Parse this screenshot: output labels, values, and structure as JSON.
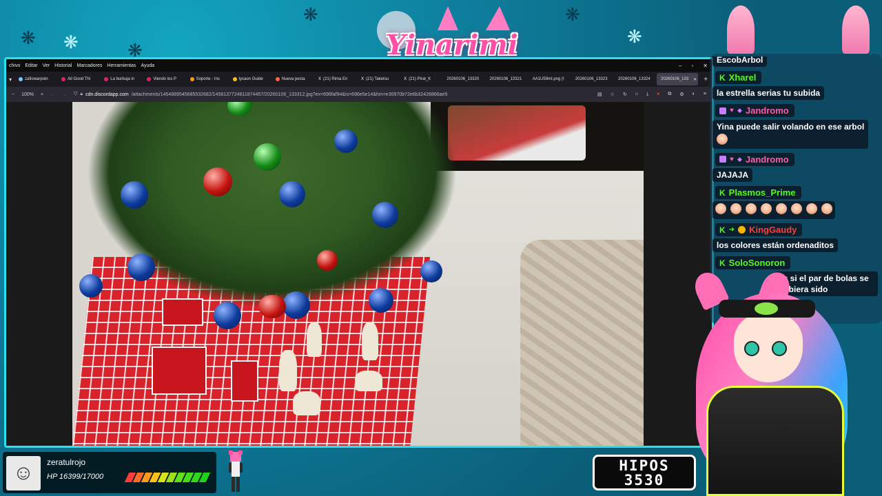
{
  "overlay": {
    "logo_text": "Yinarimi"
  },
  "browser": {
    "menu": [
      "chivo",
      "Editar",
      "Ver",
      "Historial",
      "Marcadores",
      "Herramientas",
      "Ayuda"
    ],
    "tabs": [
      {
        "label": "zafiowarpoin",
        "active": false
      },
      {
        "label": "All Good Thi",
        "active": false
      },
      {
        "label": "La burbuja in",
        "active": false
      },
      {
        "label": "Viendo los P",
        "active": false
      },
      {
        "label": "Soporte - Ins",
        "active": false
      },
      {
        "label": "lycaon Guide",
        "active": false
      },
      {
        "label": "Nueva pesta",
        "active": false
      },
      {
        "label": "(21) Rima En",
        "active": false
      },
      {
        "label": "(21) Taketsu",
        "active": false
      },
      {
        "label": "(21) Pirat_K",
        "active": false
      },
      {
        "label": "20260106_13320",
        "active": false
      },
      {
        "label": "20260106_13321",
        "active": false
      },
      {
        "label": "AA1U59mI.png (I",
        "active": false
      },
      {
        "label": "20260106_13323",
        "active": false
      },
      {
        "label": "20260106_13324",
        "active": false
      },
      {
        "label": "20260106_133",
        "active": true
      }
    ],
    "zoom": "100%",
    "url_host": "cdn.discordapp.com",
    "url_path": "/attachments/1454889545685532682/1458137724811874457/20260106_133312.jpg?ex=696faf94&is=696e5e14&hm=e30970b72e6b32426866ae5"
  },
  "chat": {
    "messages": [
      {
        "user": "",
        "user_color": "#ffffff",
        "badges": [],
        "text": "EscobArbol"
      },
      {
        "user": "Xharel",
        "user_color": "#53fc18",
        "badges": [
          "kick"
        ],
        "text": "la estrella serias tu subida"
      },
      {
        "user": "Jandromo",
        "user_color": "#ff5ca8",
        "badges": [
          "sub",
          "heart"
        ],
        "text": "Yina puede salir volando en ese arbol"
      },
      {
        "user": "Jandromo",
        "user_color": "#ff5ca8",
        "badges": [
          "sub",
          "heart"
        ],
        "text": "JAJAJA"
      },
      {
        "user": "Plasmos_Prime",
        "user_color": "#53fc18",
        "badges": [
          "kick"
        ],
        "text": ""
      },
      {
        "user": "KingGaudy",
        "user_color": "#ff3b3b",
        "badges": [
          "kick",
          "arrow",
          "gold"
        ],
        "text": "los colores están ordenaditos"
      },
      {
        "user": "SoloSonoron",
        "user_color": "#53fc18",
        "badges": [
          "kick"
        ],
        "text": "as si el par de bolas se hubiera sido"
      }
    ],
    "emote_row_count": 8
  },
  "hud": {
    "viewer_name": "zeratulrojo",
    "hp_text": "HP 16399/17000",
    "hp_fraction": 0.965,
    "hipos_label": "HIPOS",
    "hipos_count": "3530"
  },
  "colors": {
    "accent": "#2ce0ef",
    "brand_pink": "#ff4fa6",
    "kick_green": "#53fc18"
  }
}
